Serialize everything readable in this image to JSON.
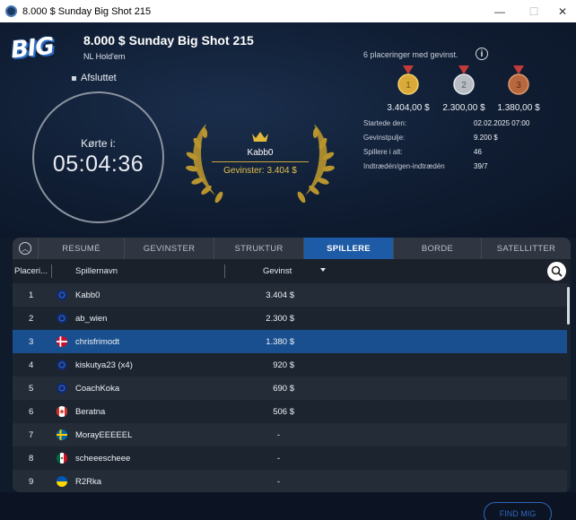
{
  "window": {
    "title": "8.000 $ Sunday Big Shot 215",
    "min": "—",
    "max": "☐",
    "close": "✕"
  },
  "header": {
    "logo_text": "BIG",
    "title": "8.000 $ Sunday Big Shot 215",
    "game": "NL Hold'em",
    "status": "Afsluttet",
    "clock_label": "Kørte i:",
    "clock_time": "05:04:36",
    "winner_name": "Kabb0",
    "winner_prize": "Gevinster: 3.404 $",
    "places_text": "6 placeringer med gevinst.",
    "info_icon": "i",
    "medals": [
      {
        "rank": "1",
        "amount": "3.404,00 $",
        "color": "#d9a93a"
      },
      {
        "rank": "2",
        "amount": "2.300,00 $",
        "color": "#b8bdc4"
      },
      {
        "rank": "3",
        "amount": "1.380,00 $",
        "color": "#b8683e"
      }
    ],
    "info": [
      {
        "key": "Startede den:",
        "value": "02.02.2025   07:00"
      },
      {
        "key": "Gevinstpulje:",
        "value": "9.200 $"
      },
      {
        "key": "Spillere i alt:",
        "value": "46"
      },
      {
        "key": "Indtrædén/gen-indtrædén",
        "value": "39/7"
      }
    ]
  },
  "tabs": [
    {
      "label": "RESUMÉ",
      "active": false
    },
    {
      "label": "GEVINSTER",
      "active": false
    },
    {
      "label": "STRUKTUR",
      "active": false
    },
    {
      "label": "SPILLERE",
      "active": true
    },
    {
      "label": "BORDE",
      "active": false
    },
    {
      "label": "SATELLITTER",
      "active": false
    }
  ],
  "table": {
    "columns": {
      "place": "Placeri...",
      "name": "Spillernavn",
      "prize": "Gevinst"
    },
    "rows": [
      {
        "place": "1",
        "flag": "intl",
        "name": "Kabb0",
        "prize": "3.404 $"
      },
      {
        "place": "2",
        "flag": "intl",
        "name": "ab_wien",
        "prize": "2.300 $"
      },
      {
        "place": "3",
        "flag": "dk",
        "name": "chrisfrimodt",
        "prize": "1.380 $",
        "selected": true
      },
      {
        "place": "4",
        "flag": "intl",
        "name": "kiskutya23 (x4)",
        "prize": "920 $"
      },
      {
        "place": "5",
        "flag": "intl",
        "name": "CoachKoka",
        "prize": "690 $"
      },
      {
        "place": "6",
        "flag": "ca",
        "name": "Beratna",
        "prize": "506 $"
      },
      {
        "place": "7",
        "flag": "se",
        "name": "MorayEEEEEL",
        "prize": "-"
      },
      {
        "place": "8",
        "flag": "mx",
        "name": "scheeescheee",
        "prize": "-"
      },
      {
        "place": "9",
        "flag": "ua",
        "name": "R2Rka",
        "prize": "-"
      }
    ]
  },
  "find_me_label": "FIND MIG"
}
